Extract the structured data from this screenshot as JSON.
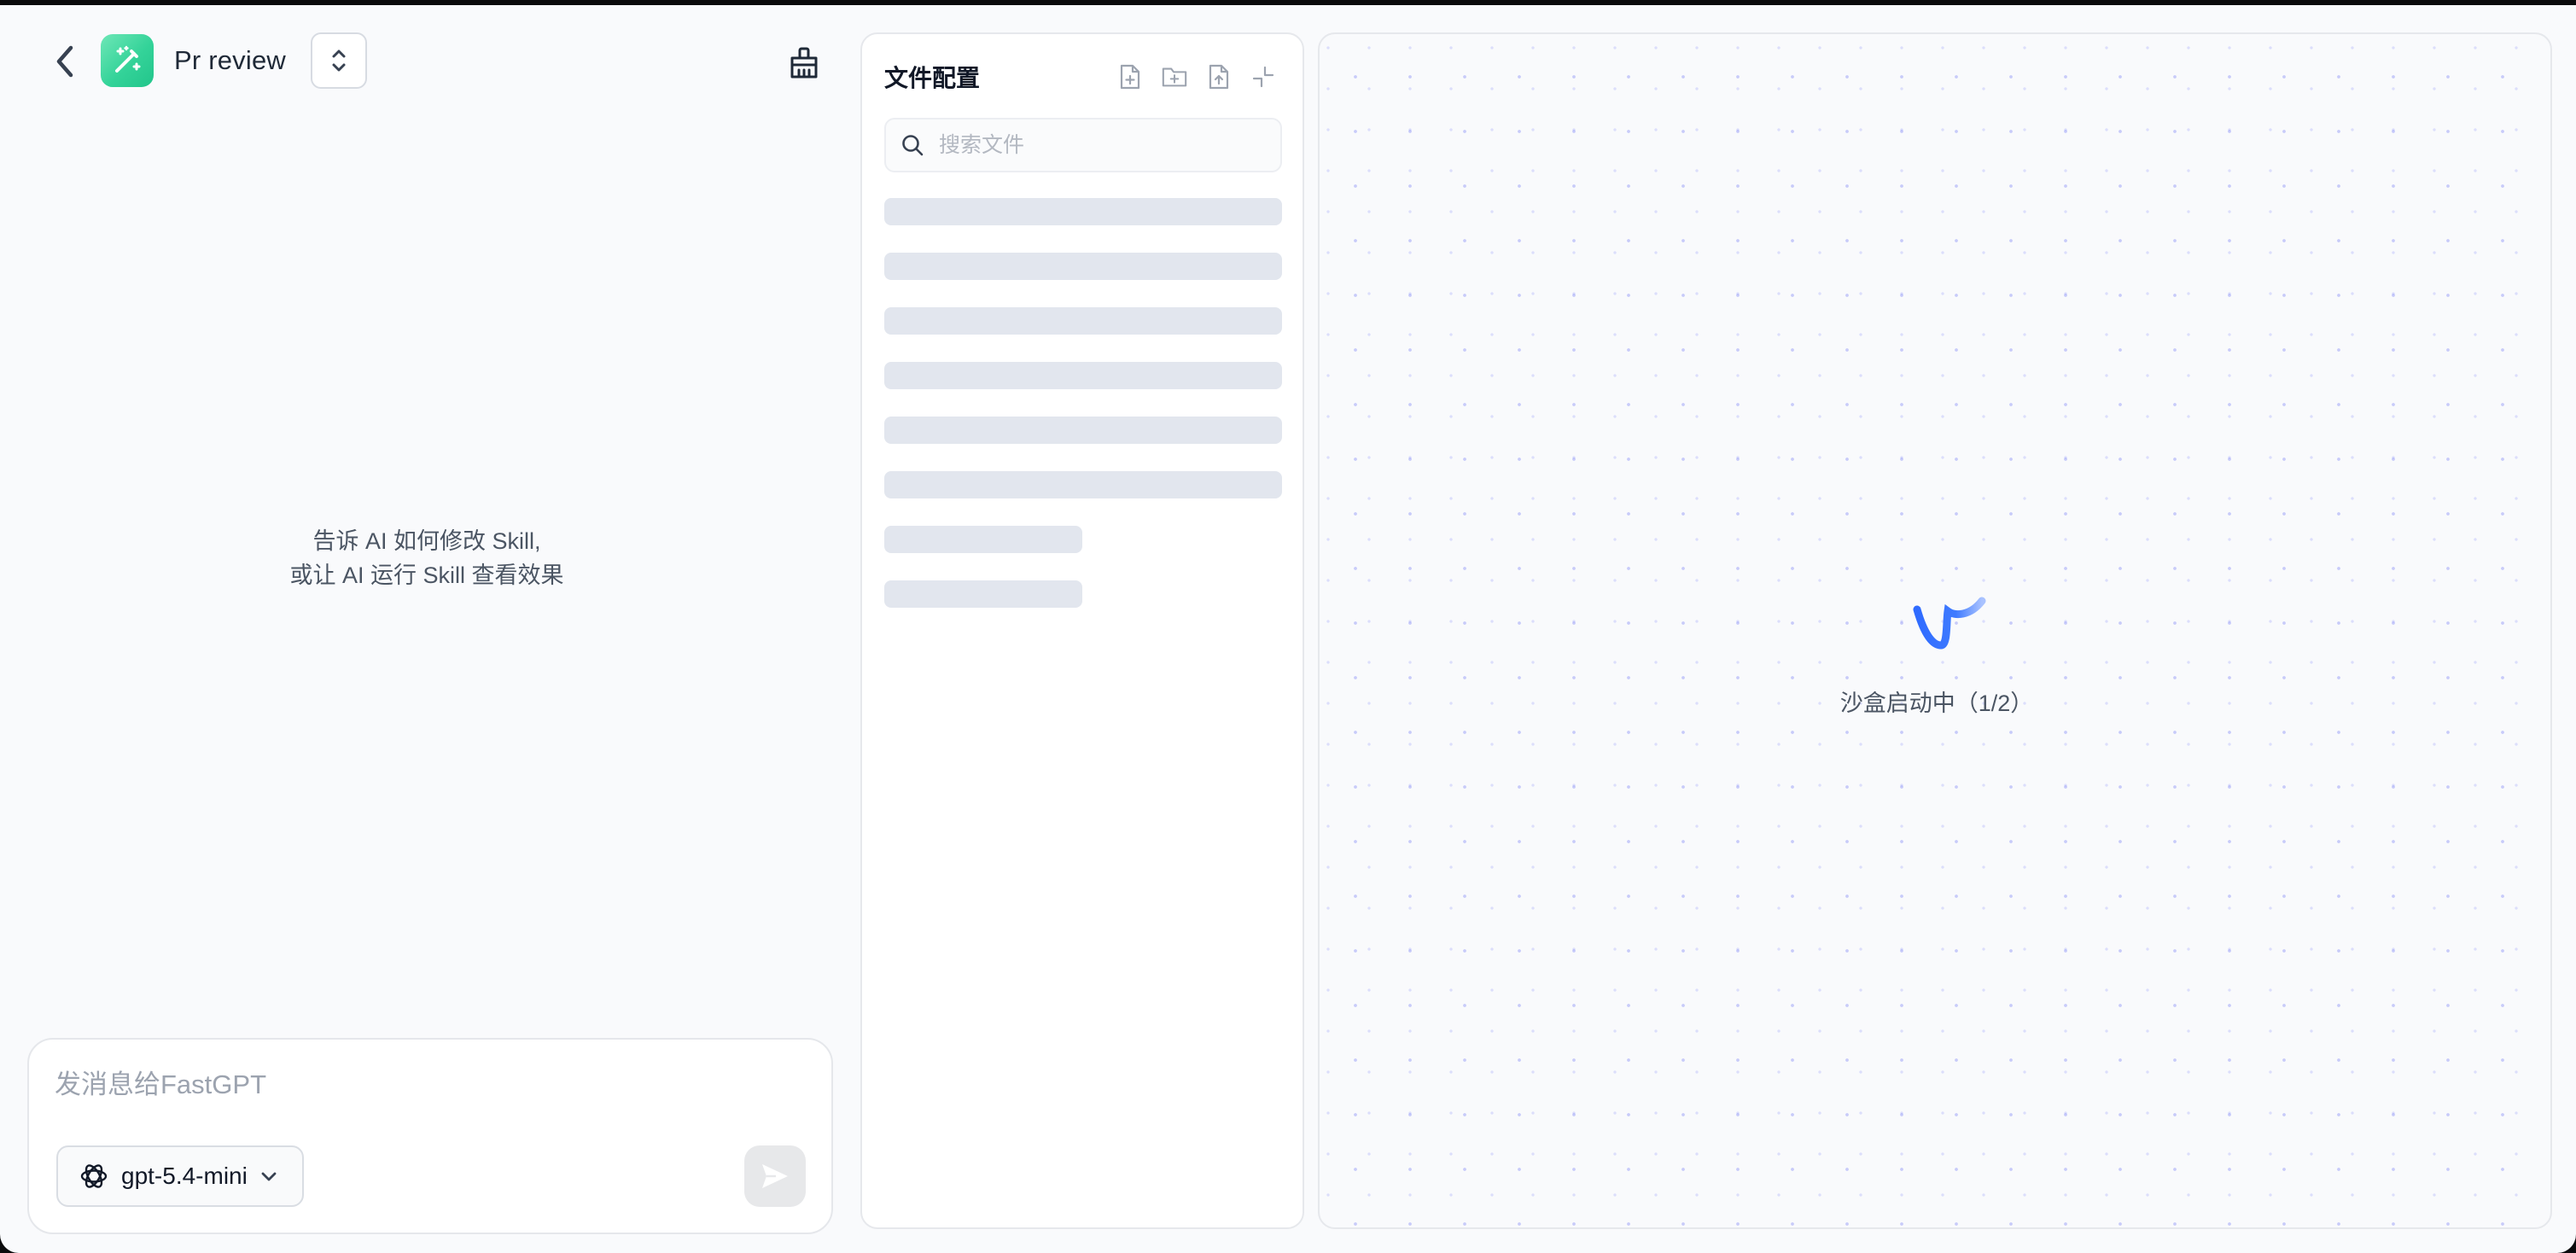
{
  "header": {
    "app_name": "Pr review",
    "back_icon": "chevron-left-icon",
    "app_icon": "magic-wand-icon",
    "switch_icon": "chevron-up-down-icon",
    "clean_icon": "broom-icon"
  },
  "chat": {
    "hint_line1": "告诉 AI 如何修改 Skill,",
    "hint_line2": "或让 AI 运行 Skill 查看效果",
    "input_placeholder": "发消息给FastGPT",
    "model_label": "gpt-5.4-mini",
    "model_icon": "openai-icon",
    "send_icon": "send-icon"
  },
  "file_panel": {
    "title": "文件配置",
    "tools": [
      "new-file-icon",
      "new-folder-icon",
      "upload-file-icon",
      "collapse-icon"
    ],
    "search_placeholder": "搜索文件",
    "loading_rows": 8
  },
  "preview": {
    "status": "沙盒启动中（1/2）"
  },
  "colors": {
    "accent": "#3370ff",
    "app_icon_bg": "#34d399",
    "dots": "#8b92f6",
    "skeleton": "#e2e6ee"
  }
}
